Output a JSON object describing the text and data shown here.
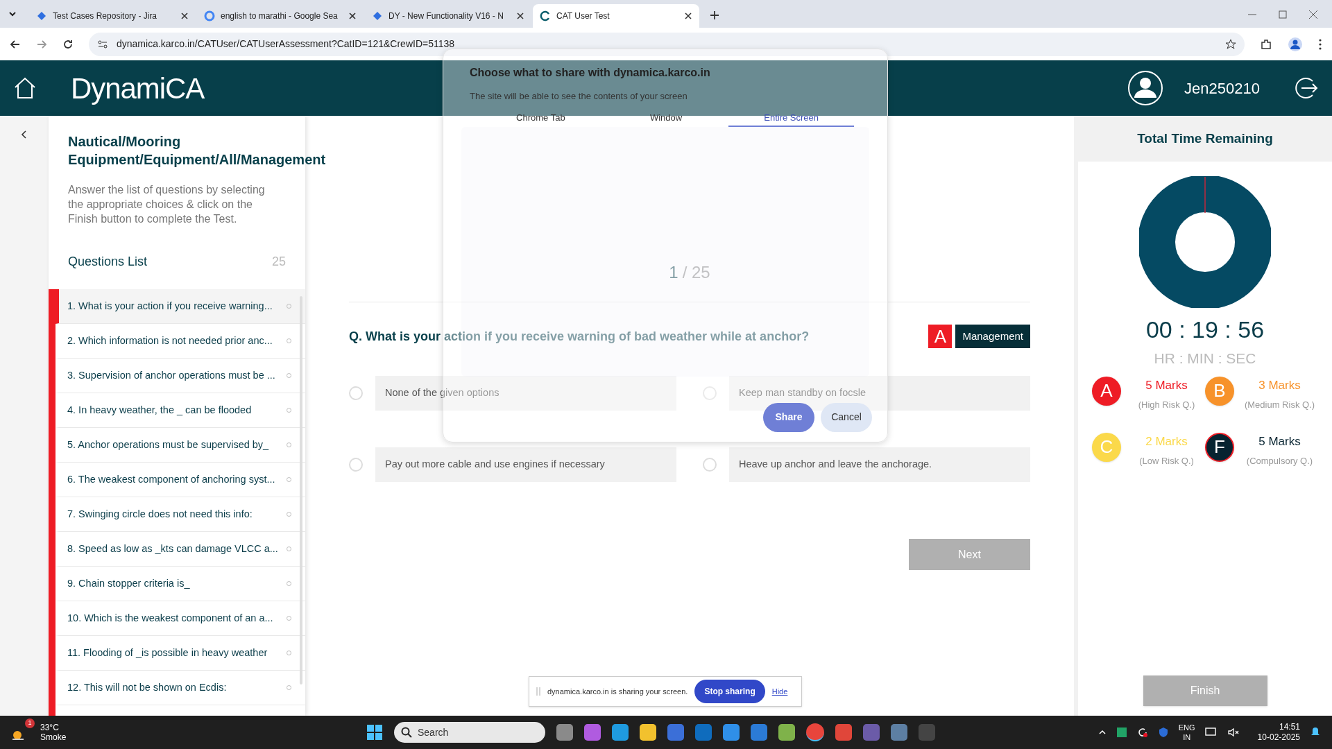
{
  "browser": {
    "tabs": [
      {
        "title": "Test Cases Repository - Jira",
        "selected": false
      },
      {
        "title": "english to marathi - Google Sea",
        "selected": false
      },
      {
        "title": "DY - New Functionality V16 - N",
        "selected": false
      },
      {
        "title": "CAT User Test",
        "selected": true
      }
    ],
    "url": "dynamica.karco.in/CATUser/CATUserAssessment?CatID=121&CrewID=51138"
  },
  "header": {
    "logo": "DynamiCA",
    "username": "Jen250210"
  },
  "sidebar": {
    "title": "Nautical/Mooring Equipment/Equipment/All/Management",
    "instructions": "Answer the list of questions by selecting the appropriate choices & click on the Finish button to complete the Test.",
    "list_title": "Questions List",
    "count": "25",
    "questions": [
      {
        "text": "1. What is your action if you receive warning...",
        "selected": true
      },
      {
        "text": "2. Which information is not needed prior anc...",
        "selected": false
      },
      {
        "text": "3. Supervision of anchor operations must be ...",
        "selected": false
      },
      {
        "text": "4. In heavy weather, the _ can be flooded",
        "selected": false
      },
      {
        "text": "5. Anchor operations must be supervised by_",
        "selected": false
      },
      {
        "text": "6. The weakest component of anchoring syst...",
        "selected": false
      },
      {
        "text": "7. Swinging circle does not need this info:",
        "selected": false
      },
      {
        "text": "8. Speed as low as _kts can damage VLCC a...",
        "selected": false
      },
      {
        "text": "9. Chain stopper criteria is_",
        "selected": false
      },
      {
        "text": "10. Which is the weakest component of an a...",
        "selected": false
      },
      {
        "text": "11. Flooding of _is possible in heavy weather",
        "selected": false
      },
      {
        "text": "12. This will not be shown on Ecdis:",
        "selected": false
      }
    ]
  },
  "question": {
    "current": "1",
    "total": "/ 25",
    "text": "Q. What is your action if you receive warning of bad weather while at anchor?",
    "risk": "A",
    "category": "Management",
    "options": [
      {
        "text": "None of the given options",
        "selected": false
      },
      {
        "text": "Keep man standby on focsle",
        "selected": false
      },
      {
        "text": "Pay out more cable and use engines if necessary",
        "selected": false
      },
      {
        "text": "Heave up anchor and leave the anchorage.",
        "selected": false
      }
    ],
    "next": "Next"
  },
  "timer": {
    "title": "Total Time Remaining",
    "time": "00 : 19 : 56",
    "units": "HR : MIN : SEC",
    "legend": [
      {
        "letter": "A",
        "marks": "5 Marks",
        "desc": "(High Risk Q.)",
        "color": "#ee1c25"
      },
      {
        "letter": "B",
        "marks": "3 Marks",
        "desc": "(Medium Risk Q.)",
        "color": "#f7922a"
      },
      {
        "letter": "C",
        "marks": "2 Marks",
        "desc": "(Low Risk Q.)",
        "color": "#fbd94a"
      },
      {
        "letter": "F",
        "marks": "5 Marks",
        "desc": "(Compulsory Q.)",
        "color": "#062330"
      }
    ],
    "finish": "Finish"
  },
  "share_dialog": {
    "title": "Choose what to share with dynamica.karco.in",
    "subtitle": "The site will be able to see the contents of your screen",
    "tabs": [
      {
        "label": "Chrome Tab",
        "selected": false
      },
      {
        "label": "Window",
        "selected": false
      },
      {
        "label": "Entire Screen",
        "selected": true
      }
    ],
    "share": "Share",
    "cancel": "Cancel"
  },
  "sharing_bar": {
    "message": "dynamica.karco.in is sharing your screen.",
    "stop": "Stop sharing",
    "hide": "Hide"
  },
  "taskbar": {
    "weather_badge": "1",
    "temperature": "33°C",
    "condition": "Smoke",
    "search": "Search",
    "lang": "ENG",
    "region": "IN",
    "time": "14:51",
    "date": "10-02-2025"
  }
}
